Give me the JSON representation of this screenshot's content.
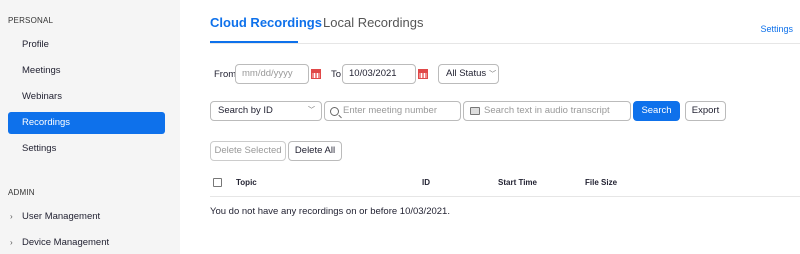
{
  "sidebar": {
    "personal_label": "PERSONAL",
    "admin_label": "ADMIN",
    "items": [
      {
        "label": "Profile"
      },
      {
        "label": "Meetings"
      },
      {
        "label": "Webinars"
      },
      {
        "label": "Recordings"
      },
      {
        "label": "Settings"
      }
    ],
    "admin_items": [
      {
        "label": "User Management"
      },
      {
        "label": "Device Management"
      }
    ]
  },
  "tabs": [
    {
      "label": "Cloud Recordings"
    },
    {
      "label": "Local Recordings"
    }
  ],
  "settings_link": "Settings",
  "filters": {
    "from_label": "From",
    "from_placeholder": "mm/dd/yyyy",
    "to_label": "To",
    "to_value": "10/03/2021",
    "status_value": "All Status"
  },
  "search": {
    "search_by_label": "Search by",
    "search_by_value": "ID",
    "meeting_placeholder": "Enter meeting number",
    "transcript_placeholder": "Search text in audio transcript",
    "search_button": "Search",
    "export_button": "Export"
  },
  "actions": {
    "delete_selected": "Delete Selected",
    "delete_all": "Delete All"
  },
  "table": {
    "columns": [
      "Topic",
      "ID",
      "Start Time",
      "File Size"
    ],
    "empty_message": "You do not have any recordings on or before 10/03/2021."
  },
  "colors": {
    "accent": "#0e71eb"
  }
}
